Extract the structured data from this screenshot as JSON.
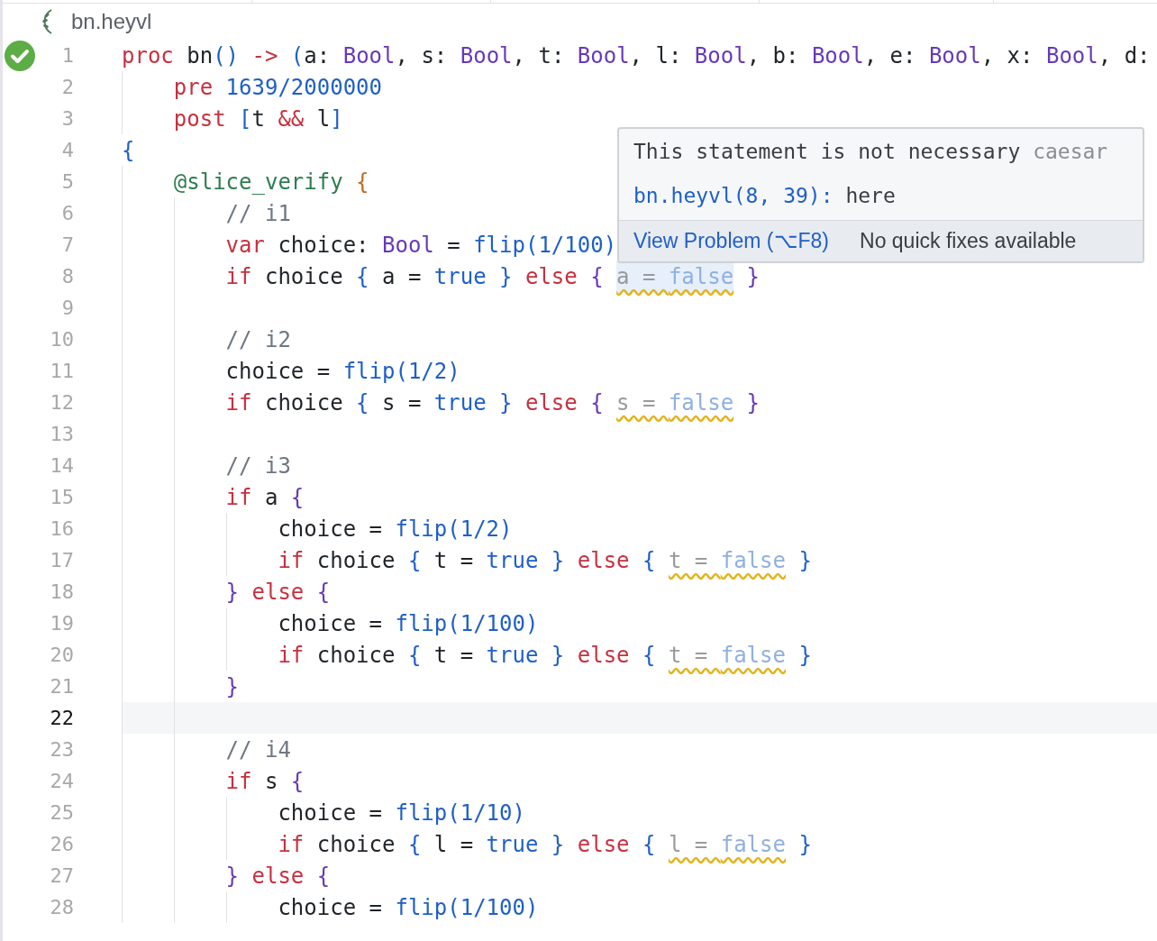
{
  "breadcrumb": {
    "file": "bn.heyvl"
  },
  "editor": {
    "lines": [
      {
        "number": "1",
        "current": false,
        "verified": true,
        "tokens": [
          {
            "text": "proc",
            "kind": "keyword"
          },
          {
            "text": " bn",
            "kind": "plain"
          },
          {
            "text": "()",
            "kind": "bracket",
            "color": "#1f5fc8"
          },
          {
            "text": " ->",
            "kind": "keyword"
          },
          {
            "text": " (",
            "kind": "bracket",
            "color": "#1f5fc8"
          },
          {
            "text": "a: ",
            "kind": "plain"
          },
          {
            "text": "Bool",
            "kind": "type"
          },
          {
            "text": ", s: ",
            "kind": "plain"
          },
          {
            "text": "Bool",
            "kind": "type"
          },
          {
            "text": ", t: ",
            "kind": "plain"
          },
          {
            "text": "Bool",
            "kind": "type"
          },
          {
            "text": ", l: ",
            "kind": "plain"
          },
          {
            "text": "Bool",
            "kind": "type"
          },
          {
            "text": ", b: ",
            "kind": "plain"
          },
          {
            "text": "Bool",
            "kind": "type"
          },
          {
            "text": ", e: ",
            "kind": "plain"
          },
          {
            "text": "Bool",
            "kind": "type"
          },
          {
            "text": ", x: ",
            "kind": "plain"
          },
          {
            "text": "Bool",
            "kind": "type"
          },
          {
            "text": ", d:",
            "kind": "plain"
          }
        ]
      },
      {
        "number": "2",
        "current": false,
        "verified": false,
        "tokens": [
          {
            "text": "    pre",
            "kind": "keyword"
          },
          {
            "text": " 1639/2000000",
            "kind": "literal"
          }
        ]
      },
      {
        "number": "3",
        "current": false,
        "verified": false,
        "tokens": [
          {
            "text": "    post",
            "kind": "keyword"
          },
          {
            "text": " [",
            "kind": "bracket",
            "color": "#1f5fc8"
          },
          {
            "text": "t ",
            "kind": "plain"
          },
          {
            "text": "&&",
            "kind": "keyword"
          },
          {
            "text": " l",
            "kind": "plain"
          },
          {
            "text": "]",
            "kind": "bracket",
            "color": "#1f5fc8"
          }
        ]
      },
      {
        "number": "4",
        "current": false,
        "verified": false,
        "tokens": [
          {
            "text": "{",
            "kind": "bracket",
            "color": "#1f5fc8"
          }
        ]
      },
      {
        "number": "5",
        "current": false,
        "verified": false,
        "tokens": [
          {
            "text": "    @slice_verify",
            "kind": "decorator"
          },
          {
            "text": " {",
            "kind": "bracket",
            "color": "#c26a1e"
          }
        ]
      },
      {
        "number": "6",
        "current": false,
        "verified": false,
        "tokens": [
          {
            "text": "        // i1",
            "kind": "comment"
          }
        ]
      },
      {
        "number": "7",
        "current": false,
        "verified": false,
        "tokens": [
          {
            "text": "        var",
            "kind": "keyword"
          },
          {
            "text": " choice: ",
            "kind": "plain"
          },
          {
            "text": "Bool",
            "kind": "type"
          },
          {
            "text": " = ",
            "kind": "plain"
          },
          {
            "text": "flip(1/100)",
            "kind": "literal"
          }
        ]
      },
      {
        "number": "8",
        "current": false,
        "verified": false,
        "tokens": [
          {
            "text": "        if",
            "kind": "keyword"
          },
          {
            "text": " choice ",
            "kind": "plain"
          },
          {
            "text": "{",
            "kind": "bracket",
            "color": "#1f5fc8"
          },
          {
            "text": " a = ",
            "kind": "plain"
          },
          {
            "text": "true",
            "kind": "literal"
          },
          {
            "text": " }",
            "kind": "bracket",
            "color": "#1f5fc8"
          },
          {
            "text": " else",
            "kind": "keyword"
          },
          {
            "text": " { ",
            "kind": "bracket",
            "color": "#6639ba"
          },
          {
            "kind": "unused",
            "hovered": true,
            "parts": [
              {
                "text": "a = ",
                "kind": "plain"
              },
              {
                "text": "false",
                "kind": "literal"
              }
            ]
          },
          {
            "text": " }",
            "kind": "bracket",
            "color": "#6639ba"
          }
        ]
      },
      {
        "number": "9",
        "current": false,
        "verified": false
      },
      {
        "number": "10",
        "current": false,
        "verified": false,
        "tokens": [
          {
            "text": "        // i2",
            "kind": "comment"
          }
        ]
      },
      {
        "number": "11",
        "current": false,
        "verified": false,
        "tokens": [
          {
            "text": "        choice = ",
            "kind": "plain"
          },
          {
            "text": "flip(1/2)",
            "kind": "literal"
          }
        ]
      },
      {
        "number": "12",
        "current": false,
        "verified": false,
        "tokens": [
          {
            "text": "        if",
            "kind": "keyword"
          },
          {
            "text": " choice ",
            "kind": "plain"
          },
          {
            "text": "{",
            "kind": "bracket",
            "color": "#1f5fc8"
          },
          {
            "text": " s = ",
            "kind": "plain"
          },
          {
            "text": "true",
            "kind": "literal"
          },
          {
            "text": " }",
            "kind": "bracket",
            "color": "#1f5fc8"
          },
          {
            "text": " else",
            "kind": "keyword"
          },
          {
            "text": " { ",
            "kind": "bracket",
            "color": "#6639ba"
          },
          {
            "kind": "unused",
            "hovered": false,
            "parts": [
              {
                "text": "s = ",
                "kind": "plain"
              },
              {
                "text": "false",
                "kind": "literal"
              }
            ]
          },
          {
            "text": " }",
            "kind": "bracket",
            "color": "#6639ba"
          }
        ]
      },
      {
        "number": "13",
        "current": false,
        "verified": false
      },
      {
        "number": "14",
        "current": false,
        "verified": false,
        "tokens": [
          {
            "text": "        // i3",
            "kind": "comment"
          }
        ]
      },
      {
        "number": "15",
        "current": false,
        "verified": false,
        "tokens": [
          {
            "text": "        if",
            "kind": "keyword"
          },
          {
            "text": " a ",
            "kind": "plain"
          },
          {
            "text": "{",
            "kind": "bracket",
            "color": "#6639ba"
          }
        ]
      },
      {
        "number": "16",
        "current": false,
        "verified": false,
        "tokens": [
          {
            "text": "            choice = ",
            "kind": "plain"
          },
          {
            "text": "flip(1/2)",
            "kind": "literal"
          }
        ]
      },
      {
        "number": "17",
        "current": false,
        "verified": false,
        "tokens": [
          {
            "text": "            if",
            "kind": "keyword"
          },
          {
            "text": " choice ",
            "kind": "plain"
          },
          {
            "text": "{",
            "kind": "bracket",
            "color": "#1f5fc8"
          },
          {
            "text": " t = ",
            "kind": "plain"
          },
          {
            "text": "true",
            "kind": "literal"
          },
          {
            "text": " }",
            "kind": "bracket",
            "color": "#1f5fc8"
          },
          {
            "text": " else",
            "kind": "keyword"
          },
          {
            "text": " { ",
            "kind": "bracket",
            "color": "#1f5fc8"
          },
          {
            "kind": "unused",
            "hovered": false,
            "parts": [
              {
                "text": "t = ",
                "kind": "plain"
              },
              {
                "text": "false",
                "kind": "literal"
              }
            ]
          },
          {
            "text": " }",
            "kind": "bracket",
            "color": "#1f5fc8"
          }
        ]
      },
      {
        "number": "18",
        "current": false,
        "verified": false,
        "tokens": [
          {
            "text": "        }",
            "kind": "bracket",
            "color": "#6639ba"
          },
          {
            "text": " else",
            "kind": "keyword"
          },
          {
            "text": " {",
            "kind": "bracket",
            "color": "#6639ba"
          }
        ]
      },
      {
        "number": "19",
        "current": false,
        "verified": false,
        "tokens": [
          {
            "text": "            choice = ",
            "kind": "plain"
          },
          {
            "text": "flip(1/100)",
            "kind": "literal"
          }
        ]
      },
      {
        "number": "20",
        "current": false,
        "verified": false,
        "tokens": [
          {
            "text": "            if",
            "kind": "keyword"
          },
          {
            "text": " choice ",
            "kind": "plain"
          },
          {
            "text": "{",
            "kind": "bracket",
            "color": "#1f5fc8"
          },
          {
            "text": " t = ",
            "kind": "plain"
          },
          {
            "text": "true",
            "kind": "literal"
          },
          {
            "text": " }",
            "kind": "bracket",
            "color": "#1f5fc8"
          },
          {
            "text": " else",
            "kind": "keyword"
          },
          {
            "text": " { ",
            "kind": "bracket",
            "color": "#1f5fc8"
          },
          {
            "kind": "unused",
            "hovered": false,
            "parts": [
              {
                "text": "t = ",
                "kind": "plain"
              },
              {
                "text": "false",
                "kind": "literal"
              }
            ]
          },
          {
            "text": " }",
            "kind": "bracket",
            "color": "#1f5fc8"
          }
        ]
      },
      {
        "number": "21",
        "current": false,
        "verified": false,
        "tokens": [
          {
            "text": "        }",
            "kind": "bracket",
            "color": "#6639ba"
          }
        ]
      },
      {
        "number": "22",
        "current": true,
        "verified": false
      },
      {
        "number": "23",
        "current": false,
        "verified": false,
        "tokens": [
          {
            "text": "        // i4",
            "kind": "comment"
          }
        ]
      },
      {
        "number": "24",
        "current": false,
        "verified": false,
        "tokens": [
          {
            "text": "        if",
            "kind": "keyword"
          },
          {
            "text": " s ",
            "kind": "plain"
          },
          {
            "text": "{",
            "kind": "bracket",
            "color": "#6639ba"
          }
        ]
      },
      {
        "number": "25",
        "current": false,
        "verified": false,
        "tokens": [
          {
            "text": "            choice = ",
            "kind": "plain"
          },
          {
            "text": "flip(1/10)",
            "kind": "literal"
          }
        ]
      },
      {
        "number": "26",
        "current": false,
        "verified": false,
        "tokens": [
          {
            "text": "            if",
            "kind": "keyword"
          },
          {
            "text": " choice ",
            "kind": "plain"
          },
          {
            "text": "{",
            "kind": "bracket",
            "color": "#1f5fc8"
          },
          {
            "text": " l = ",
            "kind": "plain"
          },
          {
            "text": "true",
            "kind": "literal"
          },
          {
            "text": " }",
            "kind": "bracket",
            "color": "#1f5fc8"
          },
          {
            "text": " else",
            "kind": "keyword"
          },
          {
            "text": " { ",
            "kind": "bracket",
            "color": "#1f5fc8"
          },
          {
            "kind": "unused",
            "hovered": false,
            "parts": [
              {
                "text": "l = ",
                "kind": "plain"
              },
              {
                "text": "false",
                "kind": "literal"
              }
            ]
          },
          {
            "text": " }",
            "kind": "bracket",
            "color": "#1f5fc8"
          }
        ]
      },
      {
        "number": "27",
        "current": false,
        "verified": false,
        "tokens": [
          {
            "text": "        }",
            "kind": "bracket",
            "color": "#6639ba"
          },
          {
            "text": " else",
            "kind": "keyword"
          },
          {
            "text": " {",
            "kind": "bracket",
            "color": "#6639ba"
          }
        ]
      },
      {
        "number": "28",
        "current": false,
        "verified": false,
        "tokens": [
          {
            "text": "            choice = ",
            "kind": "plain"
          },
          {
            "text": "flip(1/100)",
            "kind": "literal"
          }
        ]
      }
    ]
  },
  "hover": {
    "message": "This statement is not necessary",
    "source": "caesar",
    "location": "bn.heyvl(8, 39):",
    "location_note": "here",
    "action": "View Problem (⌥F8)",
    "quick_fix_note": "No quick fixes available"
  }
}
